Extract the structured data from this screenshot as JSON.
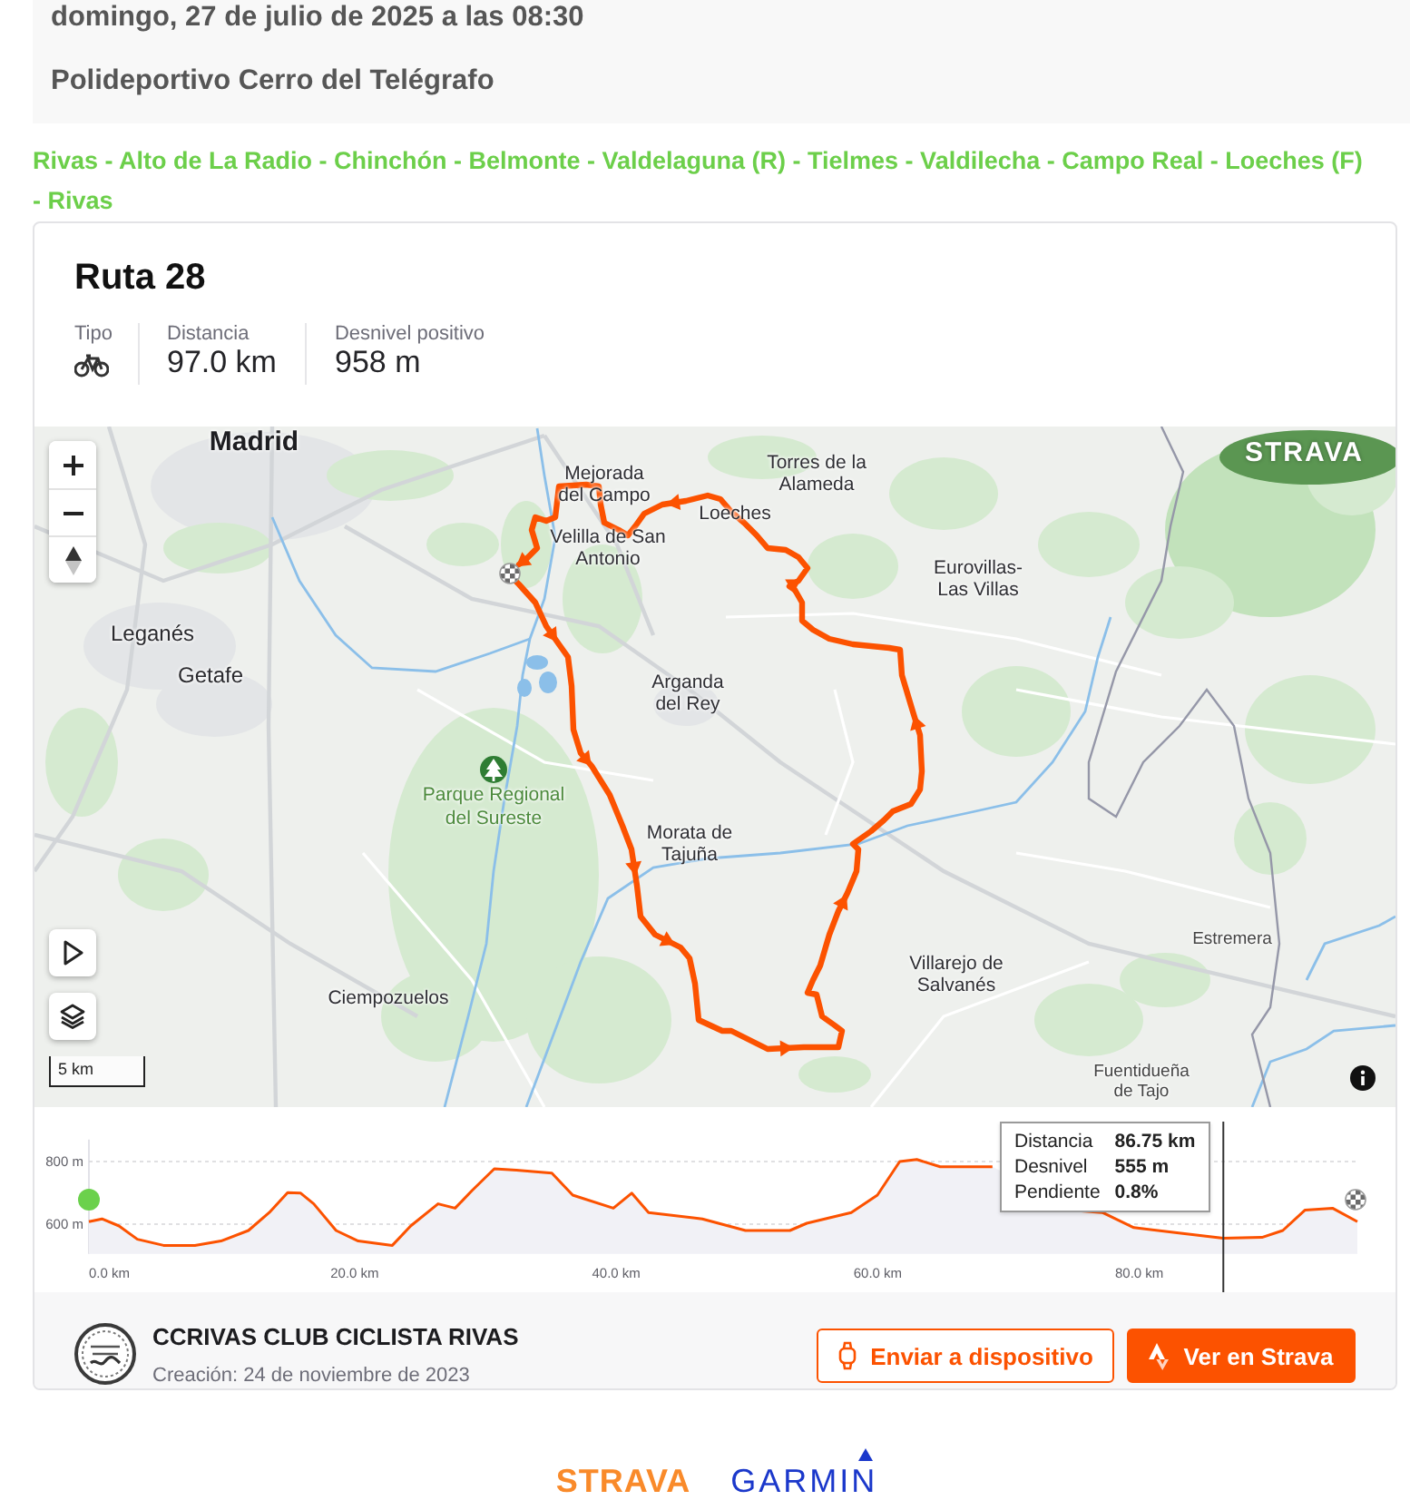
{
  "event": {
    "datetime": "domingo, 27 de julio de 2025 a las 08:30",
    "location": "Polideportivo Cerro del Telégrafo"
  },
  "route_stops": "Rivas - Alto de La Radio - Chinchón - Belmonte - Valdelaguna (R) - Tielmes - Valdilecha - Campo Real - Loeches (F) - Rivas",
  "route_card": {
    "title": "Ruta 28",
    "stats": [
      {
        "kind": "type",
        "label": "Tipo"
      },
      {
        "kind": "value",
        "label": "Distancia",
        "value": "97.0 km"
      },
      {
        "kind": "value",
        "label": "Desnivel positivo",
        "value": "958 m"
      }
    ],
    "map": {
      "logo": "STRAVA",
      "scale": "5 km",
      "labels": [
        {
          "kind": "city",
          "lines": [
            "Madrid"
          ]
        },
        {
          "kind": "town",
          "lines": [
            "Torres de la",
            "Alameda"
          ]
        },
        {
          "kind": "town",
          "lines": [
            "Mejorada",
            "del Campo"
          ]
        },
        {
          "kind": "town",
          "lines": [
            "Loeches"
          ]
        },
        {
          "kind": "town",
          "lines": [
            "Velilla de San",
            "Antonio"
          ]
        },
        {
          "kind": "town",
          "lines": [
            "Eurovillas-",
            "Las Villas"
          ]
        },
        {
          "kind": "large_town",
          "lines": [
            "Leganés"
          ]
        },
        {
          "kind": "large_town",
          "lines": [
            "Getafe"
          ]
        },
        {
          "kind": "town",
          "lines": [
            "Arganda",
            "del Rey"
          ]
        },
        {
          "kind": "park",
          "lines": [
            "Parque Regional",
            "del Sureste"
          ]
        },
        {
          "kind": "town",
          "lines": [
            "Morata de",
            "Tajuña"
          ]
        },
        {
          "kind": "village",
          "lines": [
            "Estremera"
          ]
        },
        {
          "kind": "town",
          "lines": [
            "Villarejo de",
            "Salvanés"
          ]
        },
        {
          "kind": "town",
          "lines": [
            "Ciempozuelos"
          ]
        },
        {
          "kind": "village",
          "lines": [
            "Fuentidueña",
            "de Tajo"
          ]
        }
      ]
    },
    "elevation": {
      "chart_data": {
        "type": "area",
        "x": [
          0,
          1,
          2.3,
          3.7,
          5.7,
          8.1,
          10.1,
          12.2,
          13.8,
          15.2,
          16.2,
          17.2,
          18.9,
          20.6,
          23.2,
          24.6,
          26.7,
          28.0,
          29.3,
          31.0,
          32.7,
          35.4,
          37.0,
          40.1,
          41.5,
          42.8,
          46.9,
          50.2,
          53.6,
          54.9,
          58.3,
          60.3,
          62.0,
          63.3,
          65.1,
          69.1,
          70.5,
          73.1,
          75.9,
          77.5,
          79.9,
          83.2,
          86.75,
          89.7,
          91.3,
          93.0,
          95.1,
          97.0
        ],
        "values": [
          608,
          617,
          594,
          552,
          532,
          532,
          546,
          580,
          637,
          701,
          699,
          665,
          580,
          546,
          532,
          594,
          665,
          651,
          707,
          777,
          772,
          763,
          693,
          651,
          699,
          637,
          617,
          580,
          580,
          603,
          637,
          693,
          800,
          806,
          783,
          783,
          null,
          null,
          642,
          637,
          589,
          572,
          555,
          558,
          580,
          645,
          651,
          608
        ],
        "xlim": [
          0,
          97
        ],
        "ylim": [
          505,
          870
        ],
        "xticks": [
          {
            "value": 0,
            "label": "0.0 km"
          },
          {
            "value": 20,
            "label": "20.0 km"
          },
          {
            "value": 40,
            "label": "40.0 km"
          },
          {
            "value": 60,
            "label": "60.0 km"
          },
          {
            "value": 80,
            "label": "80.0 km"
          }
        ],
        "yticks": [
          {
            "value": 600,
            "label": "600 m"
          },
          {
            "value": 800,
            "label": "800 m"
          }
        ],
        "ref_lines": [
          {
            "axis": "x",
            "value": 86.75
          }
        ]
      },
      "tooltip": [
        {
          "label": "Distancia",
          "value": "86.75 km"
        },
        {
          "label": "Desnivel",
          "value": "555 m"
        },
        {
          "label": "Pendiente",
          "value": "0.8%"
        }
      ]
    },
    "club": {
      "name": "CCRIVAS CLUB CICLISTA RIVAS",
      "created": "Creación: 24 de noviembre de 2023"
    },
    "buttons": [
      {
        "kind": "outline",
        "label": "Enviar a dispositivo"
      },
      {
        "kind": "primary",
        "label": "Ver en Strava"
      }
    ]
  },
  "partner_logos": [
    {
      "kind": "strava",
      "text": "STRAVA"
    },
    {
      "kind": "garmin",
      "text": "GARMIN"
    }
  ]
}
